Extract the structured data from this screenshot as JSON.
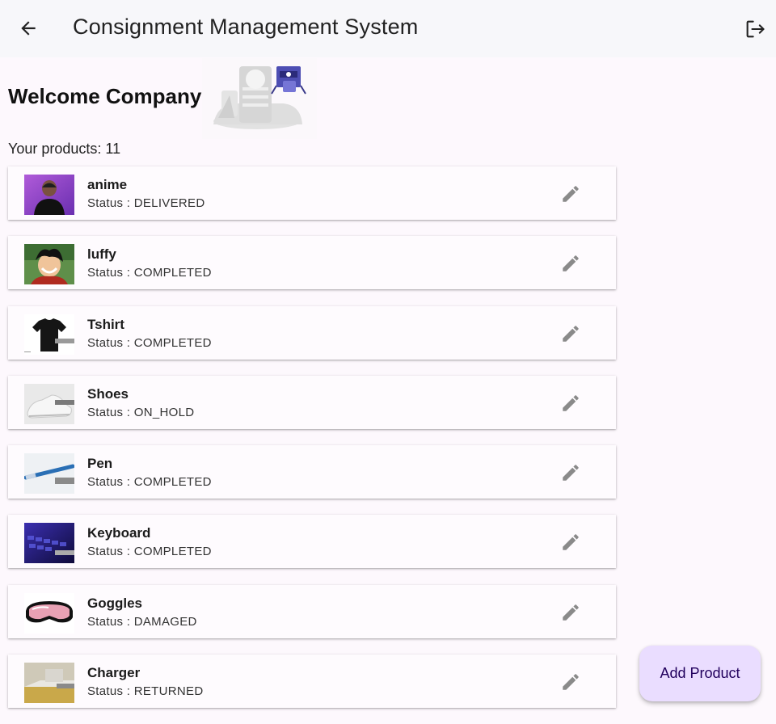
{
  "appbar": {
    "title": "Consignment Management System",
    "back_icon": "arrow-back-icon",
    "logout_icon": "logout-icon"
  },
  "welcome": "Welcome Company!",
  "products_count_label": "Your products: 11",
  "status_prefix": "Status : ",
  "products": [
    {
      "name": "anime",
      "status": "DELIVERED",
      "thumb": "person-photo"
    },
    {
      "name": "luffy",
      "status": "COMPLETED",
      "thumb": "anime-character"
    },
    {
      "name": "Tshirt",
      "status": "COMPLETED",
      "thumb": "tshirt"
    },
    {
      "name": "Shoes",
      "status": "ON_HOLD",
      "thumb": "sneakers"
    },
    {
      "name": "Pen",
      "status": "COMPLETED",
      "thumb": "pen"
    },
    {
      "name": "Keyboard",
      "status": "COMPLETED",
      "thumb": "keyboard"
    },
    {
      "name": "Goggles",
      "status": "DAMAGED",
      "thumb": "goggles"
    },
    {
      "name": "Charger",
      "status": "RETURNED",
      "thumb": "charger"
    }
  ],
  "fab": {
    "label": "Add Product"
  },
  "colors": {
    "fab_bg": "#eaddff",
    "fab_text": "#21005d",
    "appbar_bg": "#f7f7fa"
  }
}
